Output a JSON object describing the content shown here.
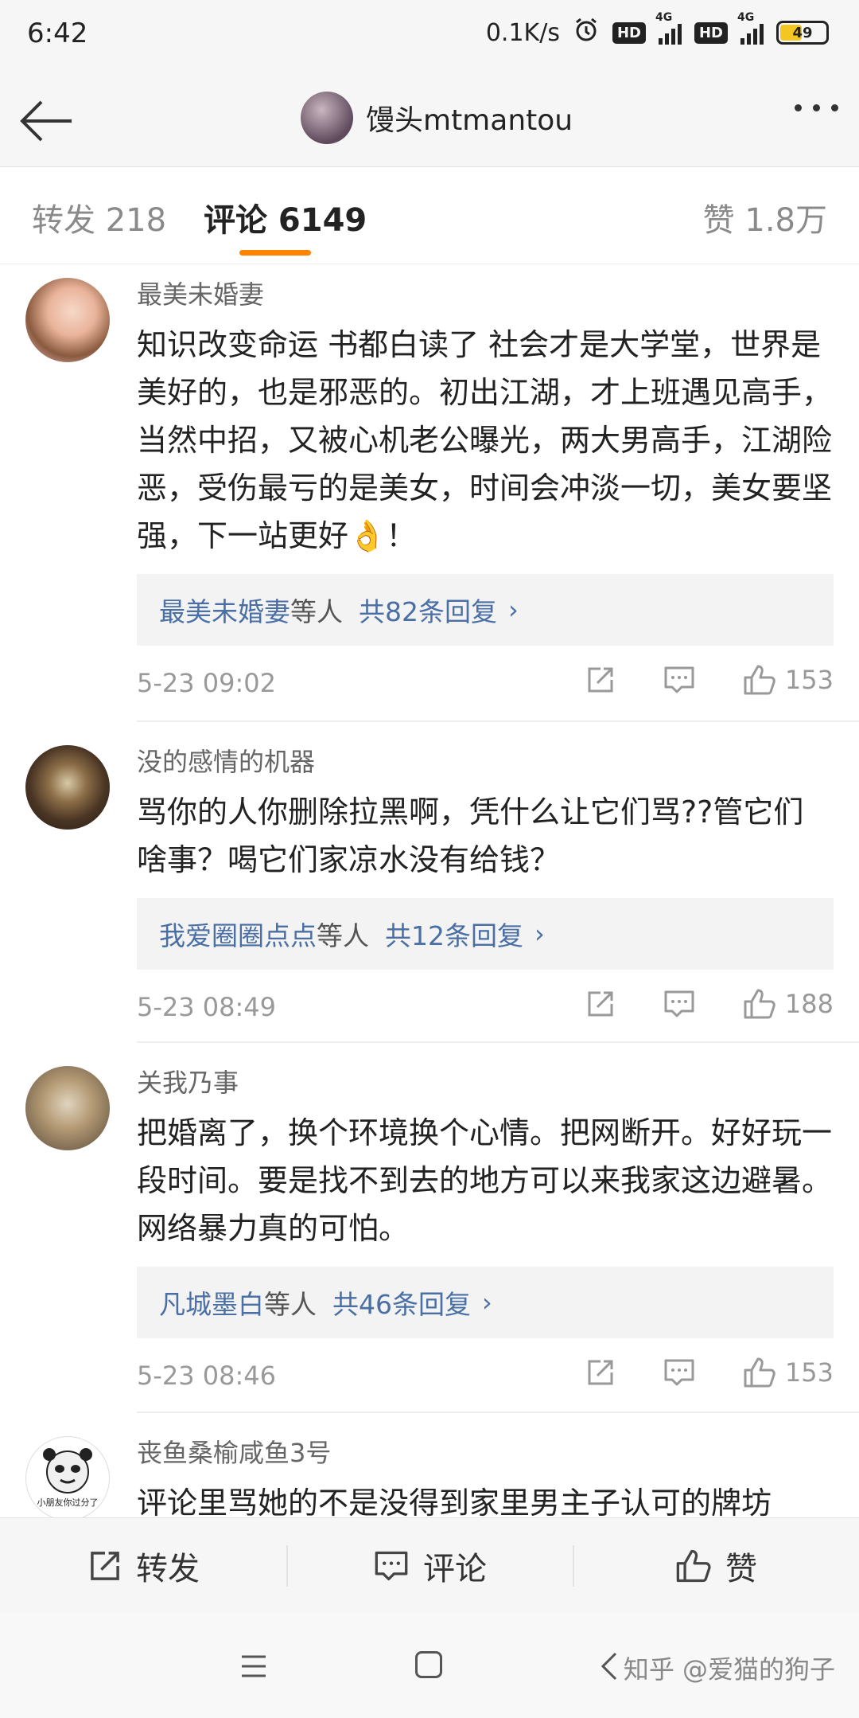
{
  "status_bar": {
    "time": "6:42",
    "network_speed": "0.1K/s",
    "hd1": "HD",
    "signal1_label": "4G",
    "hd2": "HD",
    "signal2_label": "4G",
    "battery": "49"
  },
  "header": {
    "username": "馒头mtmantou"
  },
  "tabs": {
    "repost": "转发 218",
    "comment": "评论 6149",
    "like": "赞 1.8万"
  },
  "comments": [
    {
      "name": "最美未婚妻",
      "text": "知识改变命运 书都白读了 社会才是大学堂，世界是美好的，也是邪恶的。初出江湖，才上班遇见高手，当然中招，又被心机老公曝光，两大男高手，江湖险恶，受伤最亏的是美女，时间会冲淡一切，美女要坚强，下一站更好👌！",
      "reply_user": "最美未婚妻",
      "reply_etc": "等人",
      "reply_count": "共82条回复",
      "time": "5-23 09:02",
      "likes": "153"
    },
    {
      "name": "没的感情的机器",
      "text": "骂你的人你删除拉黑啊，凭什么让它们骂??管它们啥事？喝它们家凉水没有给钱？",
      "reply_user": "我爱圈圈点点",
      "reply_etc": "等人",
      "reply_count": "共12条回复",
      "time": "5-23 08:49",
      "likes": "188"
    },
    {
      "name": "关我乃事",
      "text": "把婚离了，换个环境换个心情。把网断开。好好玩一段时间。要是找不到去的地方可以来我家这边避暑。网络暴力真的可怕。",
      "reply_user": "凡城墨白",
      "reply_etc": "等人",
      "reply_count": "共46条回复",
      "time": "5-23 08:46",
      "likes": "153"
    },
    {
      "name": "丧鱼桑榆咸鱼3号",
      "text": "评论里骂她的不是没得到家里男主子认可的牌坊",
      "avatar_caption": "小朋友你过分了"
    }
  ],
  "bottom_bar": {
    "repost": "转发",
    "comment": "评论",
    "like": "赞"
  },
  "nav": {
    "watermark": "知乎 @爱猫的狗子"
  },
  "colors": {
    "accent": "#ff8200",
    "link": "#4a6fa5",
    "muted": "#999999"
  }
}
